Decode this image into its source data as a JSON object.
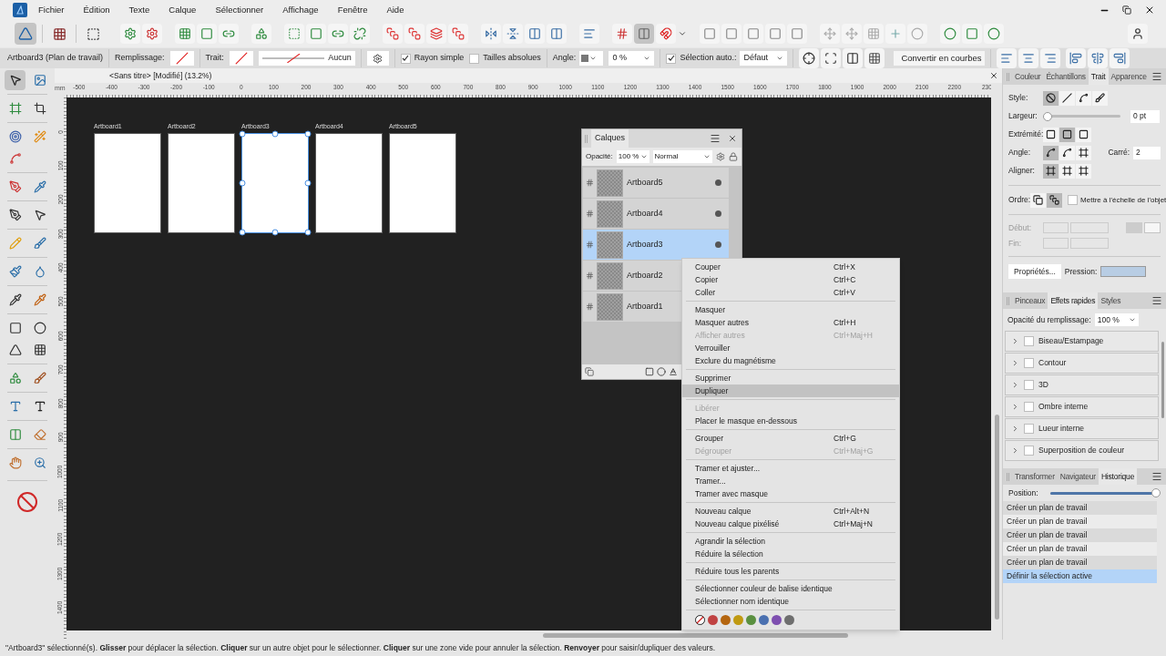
{
  "menu_bar": {
    "items": [
      "Fichier",
      "Édition",
      "Texte",
      "Calque",
      "Sélectionner",
      "Affichage",
      "Fenêtre",
      "Aide"
    ]
  },
  "personas": [
    {
      "selected": true
    },
    {
      "selected": false
    },
    {
      "selected": false
    }
  ],
  "context_toolbar": {
    "object_label": "Artboard3 (Plan de travail)",
    "fill_label": "Remplissage:",
    "stroke_label": "Trait:",
    "stroke_style": "Aucun",
    "rayon_simple": {
      "label": "Rayon simple",
      "checked": true
    },
    "tailles_absolues": {
      "label": "Tailles absolues",
      "checked": false
    },
    "angle_label": "Angle:",
    "angle_value": "0 %",
    "selection_auto": {
      "label": "Sélection auto.:",
      "checked": true
    },
    "selection_mode": "Défaut",
    "convert_button": "Convertir en courbes"
  },
  "document_tab": {
    "title": "<Sans titre> [Modifié] (13.2%)"
  },
  "ruler_unit": "mm",
  "h_ruler": [
    "-500",
    "-400",
    "-300",
    "-200",
    "-100",
    "0",
    "100",
    "200",
    "300",
    "400",
    "500",
    "600",
    "700",
    "800",
    "900",
    "1000",
    "1100",
    "1200",
    "1300",
    "1400",
    "1500",
    "1600",
    "1700",
    "1800",
    "1900",
    "2000",
    "2100",
    "2200",
    "230"
  ],
  "v_ruler": [
    "0",
    "100",
    "200",
    "300",
    "400",
    "500",
    "600",
    "700",
    "800",
    "900",
    "1000",
    "1100",
    "1200",
    "1300",
    "1400"
  ],
  "artboards": [
    {
      "name": "Artboard1",
      "selected": false
    },
    {
      "name": "Artboard2",
      "selected": false
    },
    {
      "name": "Artboard3",
      "selected": true
    },
    {
      "name": "Artboard4",
      "selected": false
    },
    {
      "name": "Artboard5",
      "selected": false
    }
  ],
  "layers_panel": {
    "tab": "Calques",
    "opacity_label": "Opacité:",
    "opacity": "100 %",
    "blend_mode": "Normal",
    "layers": [
      {
        "name": "Artboard5",
        "selected": false
      },
      {
        "name": "Artboard4",
        "selected": false
      },
      {
        "name": "Artboard3",
        "selected": true
      },
      {
        "name": "Artboard2",
        "selected": false
      },
      {
        "name": "Artboard1",
        "selected": false
      }
    ]
  },
  "context_menu": {
    "items": [
      {
        "kind": "item",
        "label": "Couper",
        "shortcut": "Ctrl+X",
        "disabled": false,
        "selected": false
      },
      {
        "kind": "item",
        "label": "Copier",
        "shortcut": "Ctrl+C",
        "disabled": false,
        "selected": false
      },
      {
        "kind": "item",
        "label": "Coller",
        "shortcut": "Ctrl+V",
        "disabled": false,
        "selected": false
      },
      {
        "kind": "separator"
      },
      {
        "kind": "item",
        "label": "Masquer",
        "disabled": false,
        "selected": false
      },
      {
        "kind": "item",
        "label": "Masquer autres",
        "shortcut": "Ctrl+H",
        "disabled": false,
        "selected": false
      },
      {
        "kind": "item",
        "label": "Afficher autres",
        "shortcut": "Ctrl+Maj+H",
        "disabled": true,
        "selected": false
      },
      {
        "kind": "item",
        "label": "Verrouiller",
        "disabled": false,
        "selected": false
      },
      {
        "kind": "item",
        "label": "Exclure du magnétisme",
        "disabled": false,
        "selected": false
      },
      {
        "kind": "separator"
      },
      {
        "kind": "item",
        "label": "Supprimer",
        "disabled": false,
        "selected": false
      },
      {
        "kind": "item",
        "label": "Dupliquer",
        "disabled": false,
        "selected": true
      },
      {
        "kind": "separator"
      },
      {
        "kind": "item",
        "label": "Libérer",
        "disabled": true,
        "selected": false
      },
      {
        "kind": "item",
        "label": "Placer le masque en-dessous",
        "disabled": false,
        "selected": false
      },
      {
        "kind": "separator"
      },
      {
        "kind": "item",
        "label": "Grouper",
        "shortcut": "Ctrl+G",
        "disabled": false,
        "selected": false
      },
      {
        "kind": "item",
        "label": "Dégrouper",
        "shortcut": "Ctrl+Maj+G",
        "disabled": true,
        "selected": false
      },
      {
        "kind": "separator"
      },
      {
        "kind": "item",
        "label": "Tramer et ajuster...",
        "disabled": false,
        "selected": false
      },
      {
        "kind": "item",
        "label": "Tramer...",
        "disabled": false,
        "selected": false
      },
      {
        "kind": "item",
        "label": "Tramer avec masque",
        "disabled": false,
        "selected": false
      },
      {
        "kind": "separator"
      },
      {
        "kind": "item",
        "label": "Nouveau calque",
        "shortcut": "Ctrl+Alt+N",
        "disabled": false,
        "selected": false
      },
      {
        "kind": "item",
        "label": "Nouveau calque pixélisé",
        "shortcut": "Ctrl+Maj+N",
        "disabled": false,
        "selected": false
      },
      {
        "kind": "separator"
      },
      {
        "kind": "item",
        "label": "Agrandir la sélection",
        "disabled": false,
        "selected": false
      },
      {
        "kind": "item",
        "label": "Réduire la sélection",
        "disabled": false,
        "selected": false
      },
      {
        "kind": "separator"
      },
      {
        "kind": "item",
        "label": "Réduire tous les parents",
        "disabled": false,
        "selected": false
      },
      {
        "kind": "separator"
      },
      {
        "kind": "item",
        "label": "Sélectionner couleur de balise identique",
        "disabled": false,
        "selected": false
      },
      {
        "kind": "item",
        "label": "Sélectionner nom identique",
        "disabled": false,
        "selected": false
      },
      {
        "kind": "separator"
      }
    ],
    "tag_colors": [
      {
        "kind": "none"
      },
      {
        "kind": "color",
        "color": "#c04242"
      },
      {
        "kind": "color",
        "color": "#b4650f"
      },
      {
        "kind": "color",
        "color": "#c09a12"
      },
      {
        "kind": "color",
        "color": "#5a9040"
      },
      {
        "kind": "color",
        "color": "#4a70b0"
      },
      {
        "kind": "color",
        "color": "#7e4fb0"
      },
      {
        "kind": "color",
        "color": "#6e6e6e"
      }
    ]
  },
  "stroke_panel": {
    "tabs": [
      {
        "label": "Couleur",
        "selected": false
      },
      {
        "label": "Échantillons",
        "selected": false
      },
      {
        "label": "Trait",
        "selected": true
      },
      {
        "label": "Apparence",
        "selected": false
      }
    ],
    "style_label": "Style:",
    "styles": [
      {
        "selected": true
      },
      {
        "selected": false
      },
      {
        "selected": false
      },
      {
        "selected": false
      }
    ],
    "width_label": "Largeur:",
    "width": {
      "level": 0
    },
    "width_value": "0 pt",
    "cap_label": "Extrémité:",
    "caps": [
      {
        "selected": false
      },
      {
        "selected": true
      },
      {
        "selected": false
      }
    ],
    "join_label": "Angle:",
    "joins": [
      {
        "selected": true
      },
      {
        "selected": false
      },
      {
        "selected": false
      }
    ],
    "miter_label": "Carré:",
    "miter_value": "2",
    "align_label": "Aligner:",
    "aligns": [
      {
        "selected": true
      },
      {
        "selected": false
      },
      {
        "selected": false
      }
    ],
    "order_label": "Ordre:",
    "orders": [
      {
        "selected": false
      },
      {
        "selected": true
      }
    ],
    "scale_with_object": {
      "label": "Mettre à l'échelle de l'objet",
      "checked": false
    },
    "start_label": "Début:",
    "end_label": "Fin:",
    "properties_button": "Propriétés...",
    "pressure_label": "Pression:"
  },
  "effects_panel": {
    "tabs": [
      {
        "label": "Pinceaux",
        "selected": false
      },
      {
        "label": "Effets rapides",
        "selected": true
      },
      {
        "label": "Styles",
        "selected": false
      }
    ],
    "fill_opacity_label": "Opacité du remplissage:",
    "fill_opacity": "100 %",
    "effects": [
      {
        "label": "Biseau/Estampage",
        "checked": false
      },
      {
        "label": "Contour",
        "checked": false
      },
      {
        "label": "3D",
        "checked": false
      },
      {
        "label": "Ombre interne",
        "checked": false
      },
      {
        "label": "Lueur interne",
        "checked": false
      },
      {
        "label": "Superposition de couleur",
        "checked": false
      }
    ]
  },
  "history_panel": {
    "tabs": [
      {
        "label": "Transformer",
        "selected": false
      },
      {
        "label": "Navigateur",
        "selected": false
      },
      {
        "label": "Historique",
        "selected": true
      }
    ],
    "position_label": "Position:",
    "position": {
      "level": 1
    },
    "items": [
      {
        "label": "Créer un plan de travail",
        "selected": false
      },
      {
        "label": "Créer un plan de travail",
        "selected": false
      },
      {
        "label": "Créer un plan de travail",
        "selected": false
      },
      {
        "label": "Créer un plan de travail",
        "selected": false
      },
      {
        "label": "Créer un plan de travail",
        "selected": false
      },
      {
        "label": "Définir la sélection active",
        "selected": true
      }
    ]
  },
  "status_bar": {
    "text": "\"Artboard3\" sélectionné(s). **Glisser** pour déplacer la sélection. **Cliquer** sur un autre objet pour le sélectionner. **Cliquer** sur une zone vide pour annuler la sélection. **Renvoyer** pour saisir/dupliquer des valeurs."
  }
}
